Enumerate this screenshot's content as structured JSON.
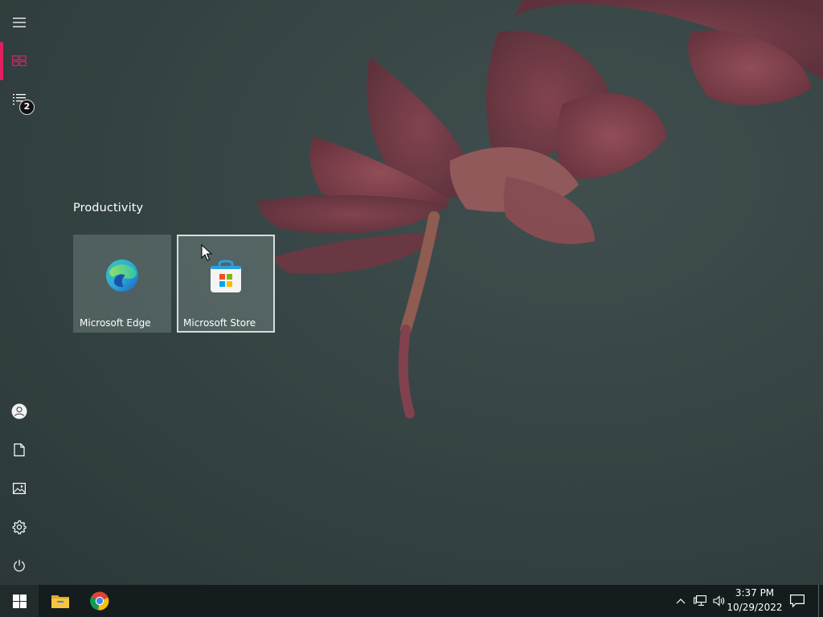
{
  "start_menu": {
    "group_title": "Productivity",
    "rail": {
      "expand_icon": "hamburger-menu-icon",
      "pinned_tiles_icon": "tiles-icon",
      "all_apps_icon": "list-icon",
      "all_apps_badge": "2",
      "bottom_icons": [
        "user-icon",
        "document-icon",
        "pictures-icon",
        "gear-icon",
        "power-icon"
      ],
      "accent_color": "#e02060"
    },
    "tiles": [
      {
        "label": "Microsoft Edge",
        "icon": "edge-icon"
      },
      {
        "label": "Microsoft Store",
        "icon": "store-icon"
      }
    ]
  },
  "taskbar": {
    "start_icon": "windows-logo-icon",
    "pinned": [
      {
        "name": "File Explorer",
        "icon": "folder-icon"
      },
      {
        "name": "Google Chrome",
        "icon": "chrome-icon"
      }
    ],
    "tray": {
      "icons": [
        "chevron-up-icon",
        "network-icon",
        "volume-icon"
      ],
      "time": "3:37 PM",
      "date": "10/29/2022",
      "action_center_icon": "notification-icon"
    }
  }
}
